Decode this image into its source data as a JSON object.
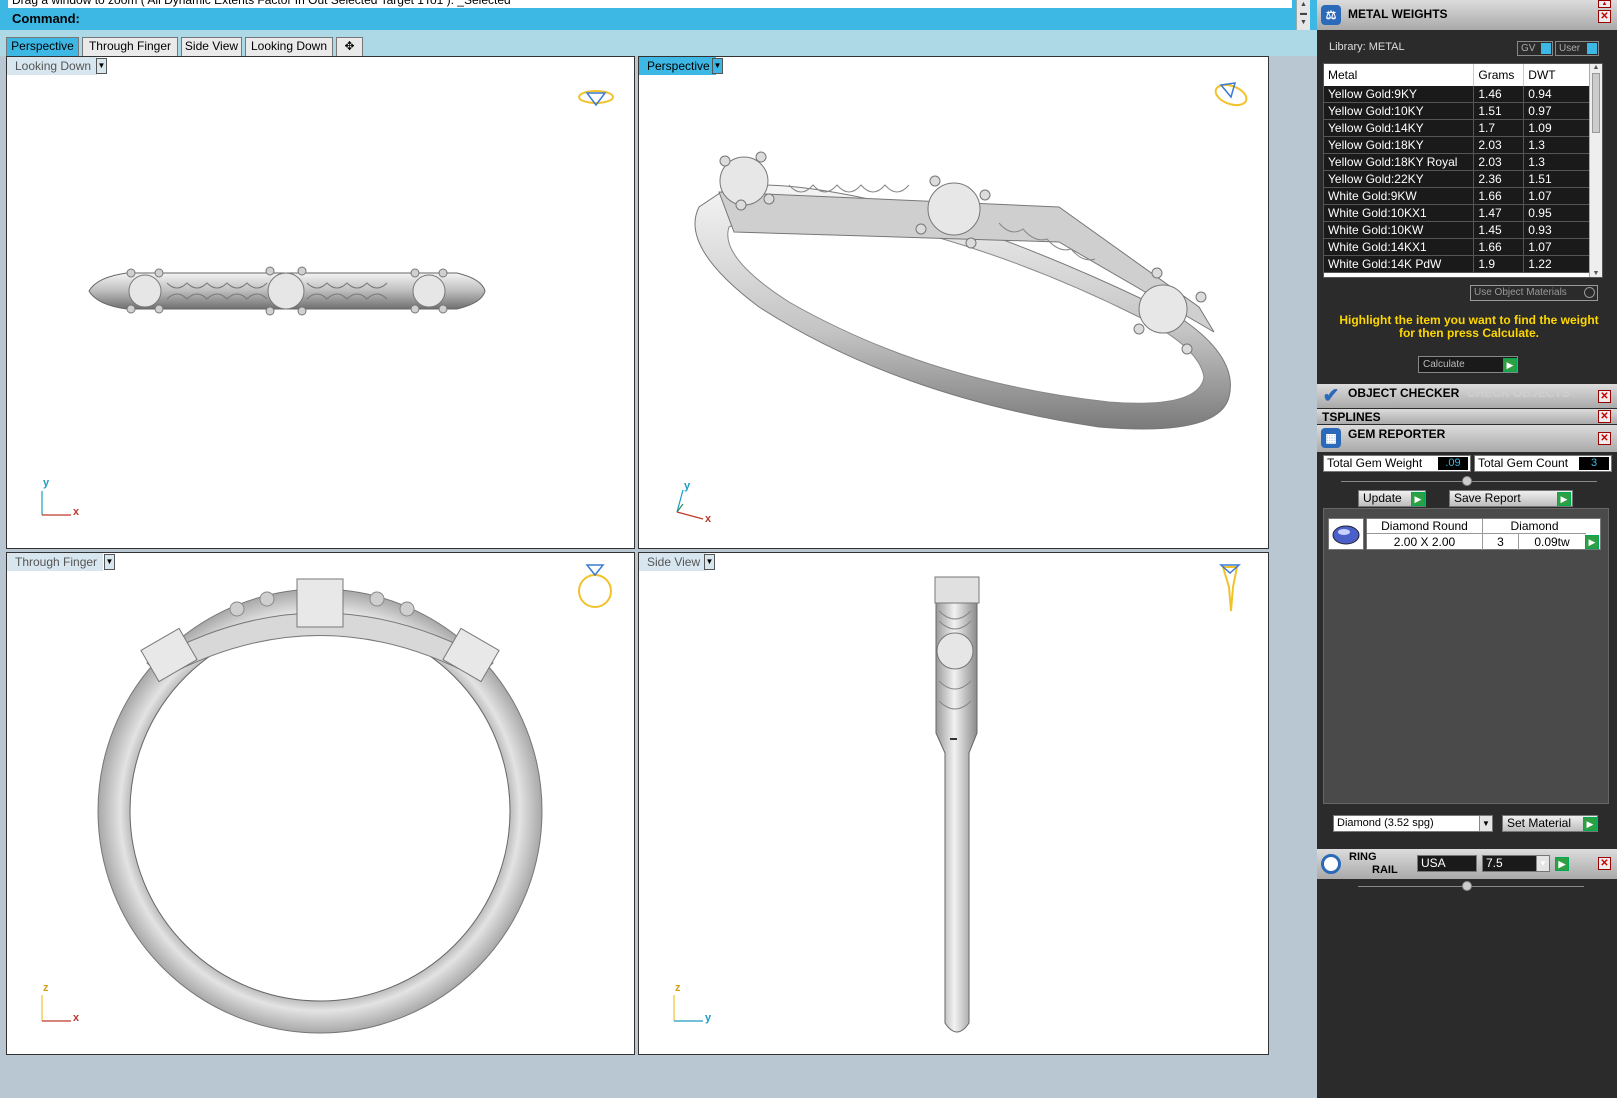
{
  "command": {
    "history_line": "Drag a window to zoom ( All  Dynamic  Extents  Factor  In  Out  Selected  Target  1To1 ): _Selected",
    "prompt": "Command:"
  },
  "tabs": [
    {
      "label": "Perspective"
    },
    {
      "label": "Through Finger"
    },
    {
      "label": "Side View"
    },
    {
      "label": "Looking Down"
    },
    {
      "label": "✥"
    }
  ],
  "viewports": {
    "looking_down": {
      "label": "Looking Down",
      "axis_x": "x",
      "axis_y": "y"
    },
    "perspective": {
      "label": "Perspective",
      "axis_x": "x",
      "axis_y": "y"
    },
    "through_finger": {
      "label": "Through Finger",
      "axis_x": "x",
      "axis_y": "z"
    },
    "side_view": {
      "label": "Side View",
      "axis_x": "y",
      "axis_y": "z"
    }
  },
  "metal_weights": {
    "title": "METAL WEIGHTS",
    "library": "Library: METAL",
    "gv": "GV",
    "user": "User",
    "columns": [
      "Metal",
      "Grams",
      "DWT"
    ],
    "rows": [
      [
        "Yellow Gold:9KY",
        "1.46",
        "0.94"
      ],
      [
        "Yellow Gold:10KY",
        "1.51",
        "0.97"
      ],
      [
        "Yellow Gold:14KY",
        "1.7",
        "1.09"
      ],
      [
        "Yellow Gold:18KY",
        "2.03",
        "1.3"
      ],
      [
        "Yellow Gold:18KY Royal",
        "2.03",
        "1.3"
      ],
      [
        "Yellow Gold:22KY",
        "2.36",
        "1.51"
      ],
      [
        "White Gold:9KW",
        "1.66",
        "1.07"
      ],
      [
        "White Gold:10KX1",
        "1.47",
        "0.95"
      ],
      [
        "White Gold:10KW",
        "1.45",
        "0.93"
      ],
      [
        "White Gold:14KX1",
        "1.66",
        "1.07"
      ],
      [
        "White Gold:14K PdW",
        "1.9",
        "1.22"
      ]
    ],
    "use_object_materials": "Use Object Materials",
    "hint": "Highlight the item you want to find the weight for then press Calculate.",
    "calculate": "Calculate"
  },
  "object_checker": {
    "title": "OBJECT CHECKER",
    "check_objects": "CHECK OBJECTS"
  },
  "tsplines": {
    "title": "TSPLINES"
  },
  "gem_reporter": {
    "title": "GEM REPORTER",
    "total_weight_label": "Total Gem Weight",
    "total_weight_value": ".09",
    "total_count_label": "Total Gem Count",
    "total_count_value": "3",
    "update": "Update",
    "save_report": "Save Report",
    "gem_shape": "Diamond Round",
    "gem_material": "Diamond",
    "gem_size": "2.00 X 2.00",
    "gem_count": "3",
    "gem_weight": "0.09tw",
    "material_select": "Diamond      (3.52 spg)",
    "set_material": "Set Material"
  },
  "ring_rail": {
    "title_line1": "RING",
    "title_line2": "RAIL",
    "standard": "USA",
    "size": "7.5"
  },
  "colors": {
    "accent": "#3db8e5",
    "panel_bg": "#2b2b2b",
    "hint_text": "#ffd700",
    "gizmo": "#f2c22b"
  }
}
